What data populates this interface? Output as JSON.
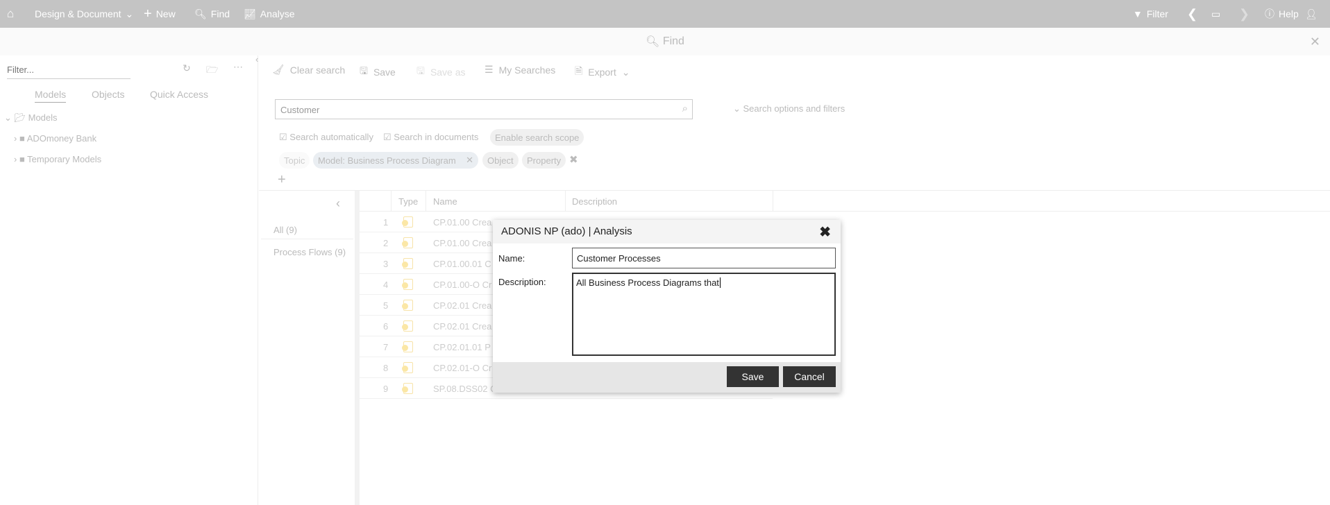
{
  "topbar": {
    "home_icon": "home-icon",
    "design": "Design & Document",
    "new": "New",
    "find": "Find",
    "analyse": "Analyse",
    "filter": "Filter",
    "help": "Help"
  },
  "findbar": {
    "title": "Find"
  },
  "left": {
    "filter_placeholder": "Filter...",
    "tabs": [
      "Models",
      "Objects",
      "Quick Access"
    ],
    "tree": {
      "root": "Models",
      "children": [
        "ADOmoney Bank",
        "Temporary Models"
      ]
    }
  },
  "toolbar": {
    "clear": "Clear search",
    "save": "Save",
    "save_as": "Save as",
    "my_searches": "My Searches",
    "export": "Export"
  },
  "search": {
    "value": "Customer",
    "options": "Search options and filters",
    "search_auto": "Search automatically",
    "search_docs": "Search in documents",
    "scope": "Enable search scope"
  },
  "chips": {
    "topic": "Topic",
    "model": "Model: Business Process Diagram",
    "object": "Object",
    "property": "Property"
  },
  "categories": [
    {
      "label": "All (9)"
    },
    {
      "label": "Process Flows (9)"
    }
  ],
  "table": {
    "headers": [
      "Type",
      "Name",
      "Description"
    ],
    "rows": [
      {
        "n": "1",
        "name": "CP.01.00 Crea"
      },
      {
        "n": "2",
        "name": "CP.01.00 Crea"
      },
      {
        "n": "3",
        "name": "CP.01.00.01 C"
      },
      {
        "n": "4",
        "name": "CP.01.00-O Cr"
      },
      {
        "n": "5",
        "name": "CP.02.01 Crea"
      },
      {
        "n": "6",
        "name": "CP.02.01 Crea"
      },
      {
        "n": "7",
        "name": "CP.02.01.01 P"
      },
      {
        "n": "8",
        "name": "CP.02.01-O Cr"
      },
      {
        "n": "9",
        "name": "SP.08.DSS02 C"
      }
    ]
  },
  "dialog": {
    "title": "ADONIS NP (ado) | Analysis",
    "name_label": "Name:",
    "name_value": "Customer Processes",
    "desc_label": "Description:",
    "desc_value": "All Business Process Diagrams that",
    "save": "Save",
    "cancel": "Cancel"
  }
}
